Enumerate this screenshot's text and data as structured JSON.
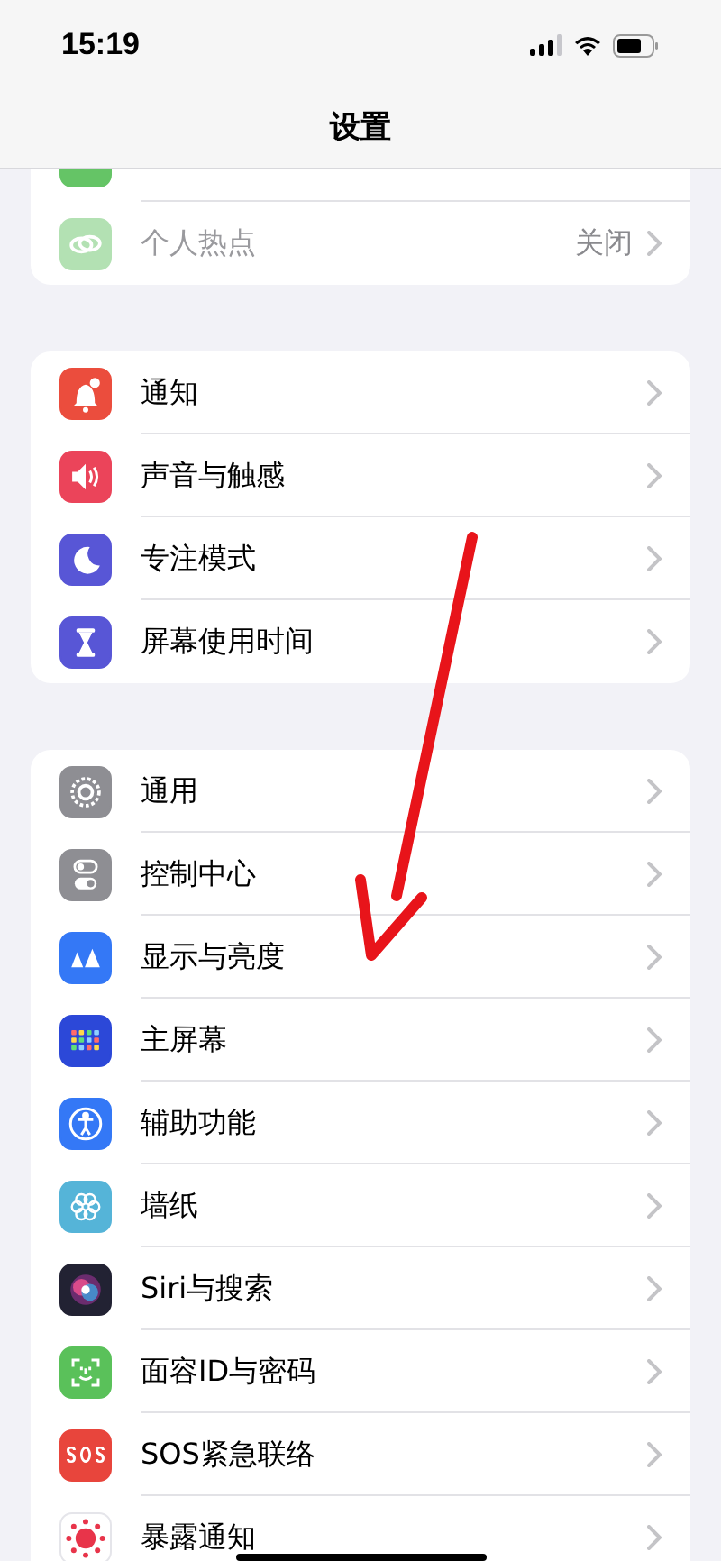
{
  "status_bar": {
    "time": "15:19"
  },
  "nav": {
    "title": "设置"
  },
  "groups": [
    {
      "items": [
        {
          "color": "#65c466",
          "disabled": false
        },
        {
          "label": "个人热点",
          "value": "关闭",
          "color": "#a6dca6",
          "disabled": true
        }
      ]
    },
    {
      "items": [
        {
          "label": "通知",
          "color": "#eb4d3d",
          "disabled": false
        },
        {
          "label": "声音与触感",
          "color": "#eb445a",
          "disabled": false
        },
        {
          "label": "专注模式",
          "color": "#5856d6",
          "disabled": false
        },
        {
          "label": "屏幕使用时间",
          "color": "#5856d6",
          "disabled": false
        }
      ]
    },
    {
      "items": [
        {
          "label": "通用",
          "color": "#8e8e93",
          "disabled": false
        },
        {
          "label": "控制中心",
          "color": "#8e8e93",
          "disabled": false
        },
        {
          "label": "显示与亮度",
          "color": "#3478f6",
          "disabled": false
        },
        {
          "label": "主屏幕",
          "color": "#2c48d8",
          "disabled": false
        },
        {
          "label": "辅助功能",
          "color": "#3478f6",
          "disabled": false
        },
        {
          "label": "墙纸",
          "color": "#55b4d8",
          "disabled": false
        },
        {
          "label": "Siri与搜索",
          "color": "#222233",
          "disabled": false
        },
        {
          "label": "面容ID与密码",
          "color": "#5ac15a",
          "disabled": false
        },
        {
          "label": "SOS紧急联络",
          "color": "#e8453c",
          "disabled": false
        },
        {
          "label": "暴露通知",
          "color": "#ffffff",
          "disabled": false
        }
      ]
    }
  ]
}
